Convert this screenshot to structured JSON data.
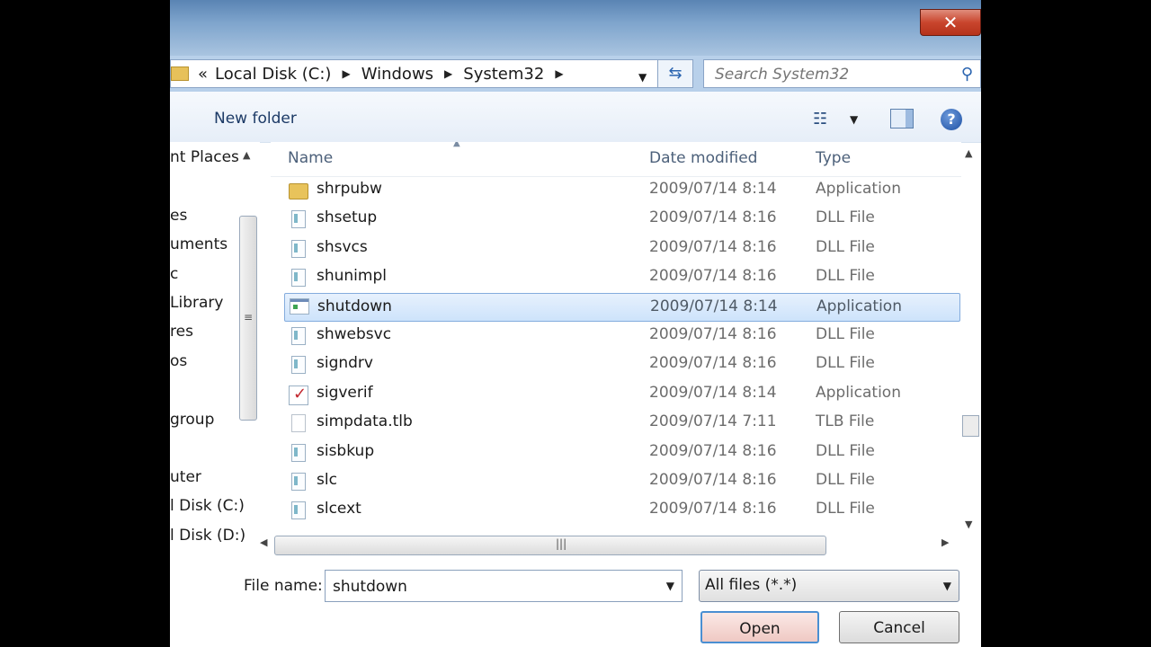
{
  "close_label": "✕",
  "address": {
    "overflow": "«",
    "crumbs": [
      "Local Disk (C:)",
      "Windows",
      "System32"
    ]
  },
  "search": {
    "placeholder": "Search System32"
  },
  "toolbar": {
    "new_folder": "New folder"
  },
  "nav": {
    "items": [
      "nt Places",
      "es",
      "uments",
      "c",
      "Library",
      "res",
      "os",
      "group",
      "uter",
      "l Disk (C:)",
      "l Disk (D:)"
    ]
  },
  "columns": {
    "name": "Name",
    "date": "Date modified",
    "type": "Type"
  },
  "files": [
    {
      "name": "shrpubw",
      "date": "2009/07/14 8:14",
      "type": "Application",
      "icon": "folder-app-icon"
    },
    {
      "name": "shsetup",
      "date": "2009/07/14 8:16",
      "type": "DLL File",
      "icon": "dll-file-icon"
    },
    {
      "name": "shsvcs",
      "date": "2009/07/14 8:16",
      "type": "DLL File",
      "icon": "dll-file-icon"
    },
    {
      "name": "shunimpl",
      "date": "2009/07/14 8:16",
      "type": "DLL File",
      "icon": "dll-file-icon"
    },
    {
      "name": "shutdown",
      "date": "2009/07/14 8:14",
      "type": "Application",
      "icon": "app-icon",
      "selected": true
    },
    {
      "name": "shwebsvc",
      "date": "2009/07/14 8:16",
      "type": "DLL File",
      "icon": "dll-file-icon"
    },
    {
      "name": "signdrv",
      "date": "2009/07/14 8:16",
      "type": "DLL File",
      "icon": "dll-file-icon"
    },
    {
      "name": "sigverif",
      "date": "2009/07/14 8:14",
      "type": "Application",
      "icon": "checkmark-app-icon"
    },
    {
      "name": "simpdata.tlb",
      "date": "2009/07/14 7:11",
      "type": "TLB File",
      "icon": "blank-file-icon"
    },
    {
      "name": "sisbkup",
      "date": "2009/07/14 8:16",
      "type": "DLL File",
      "icon": "dll-file-icon"
    },
    {
      "name": "slc",
      "date": "2009/07/14 8:16",
      "type": "DLL File",
      "icon": "dll-file-icon"
    },
    {
      "name": "slcext",
      "date": "2009/07/14 8:16",
      "type": "DLL File",
      "icon": "dll-file-icon"
    }
  ],
  "footer": {
    "file_name_label": "File name:",
    "file_name_value": "shutdown",
    "file_type": "All files (*.*)",
    "open_label": "Open",
    "cancel_label": "Cancel"
  }
}
